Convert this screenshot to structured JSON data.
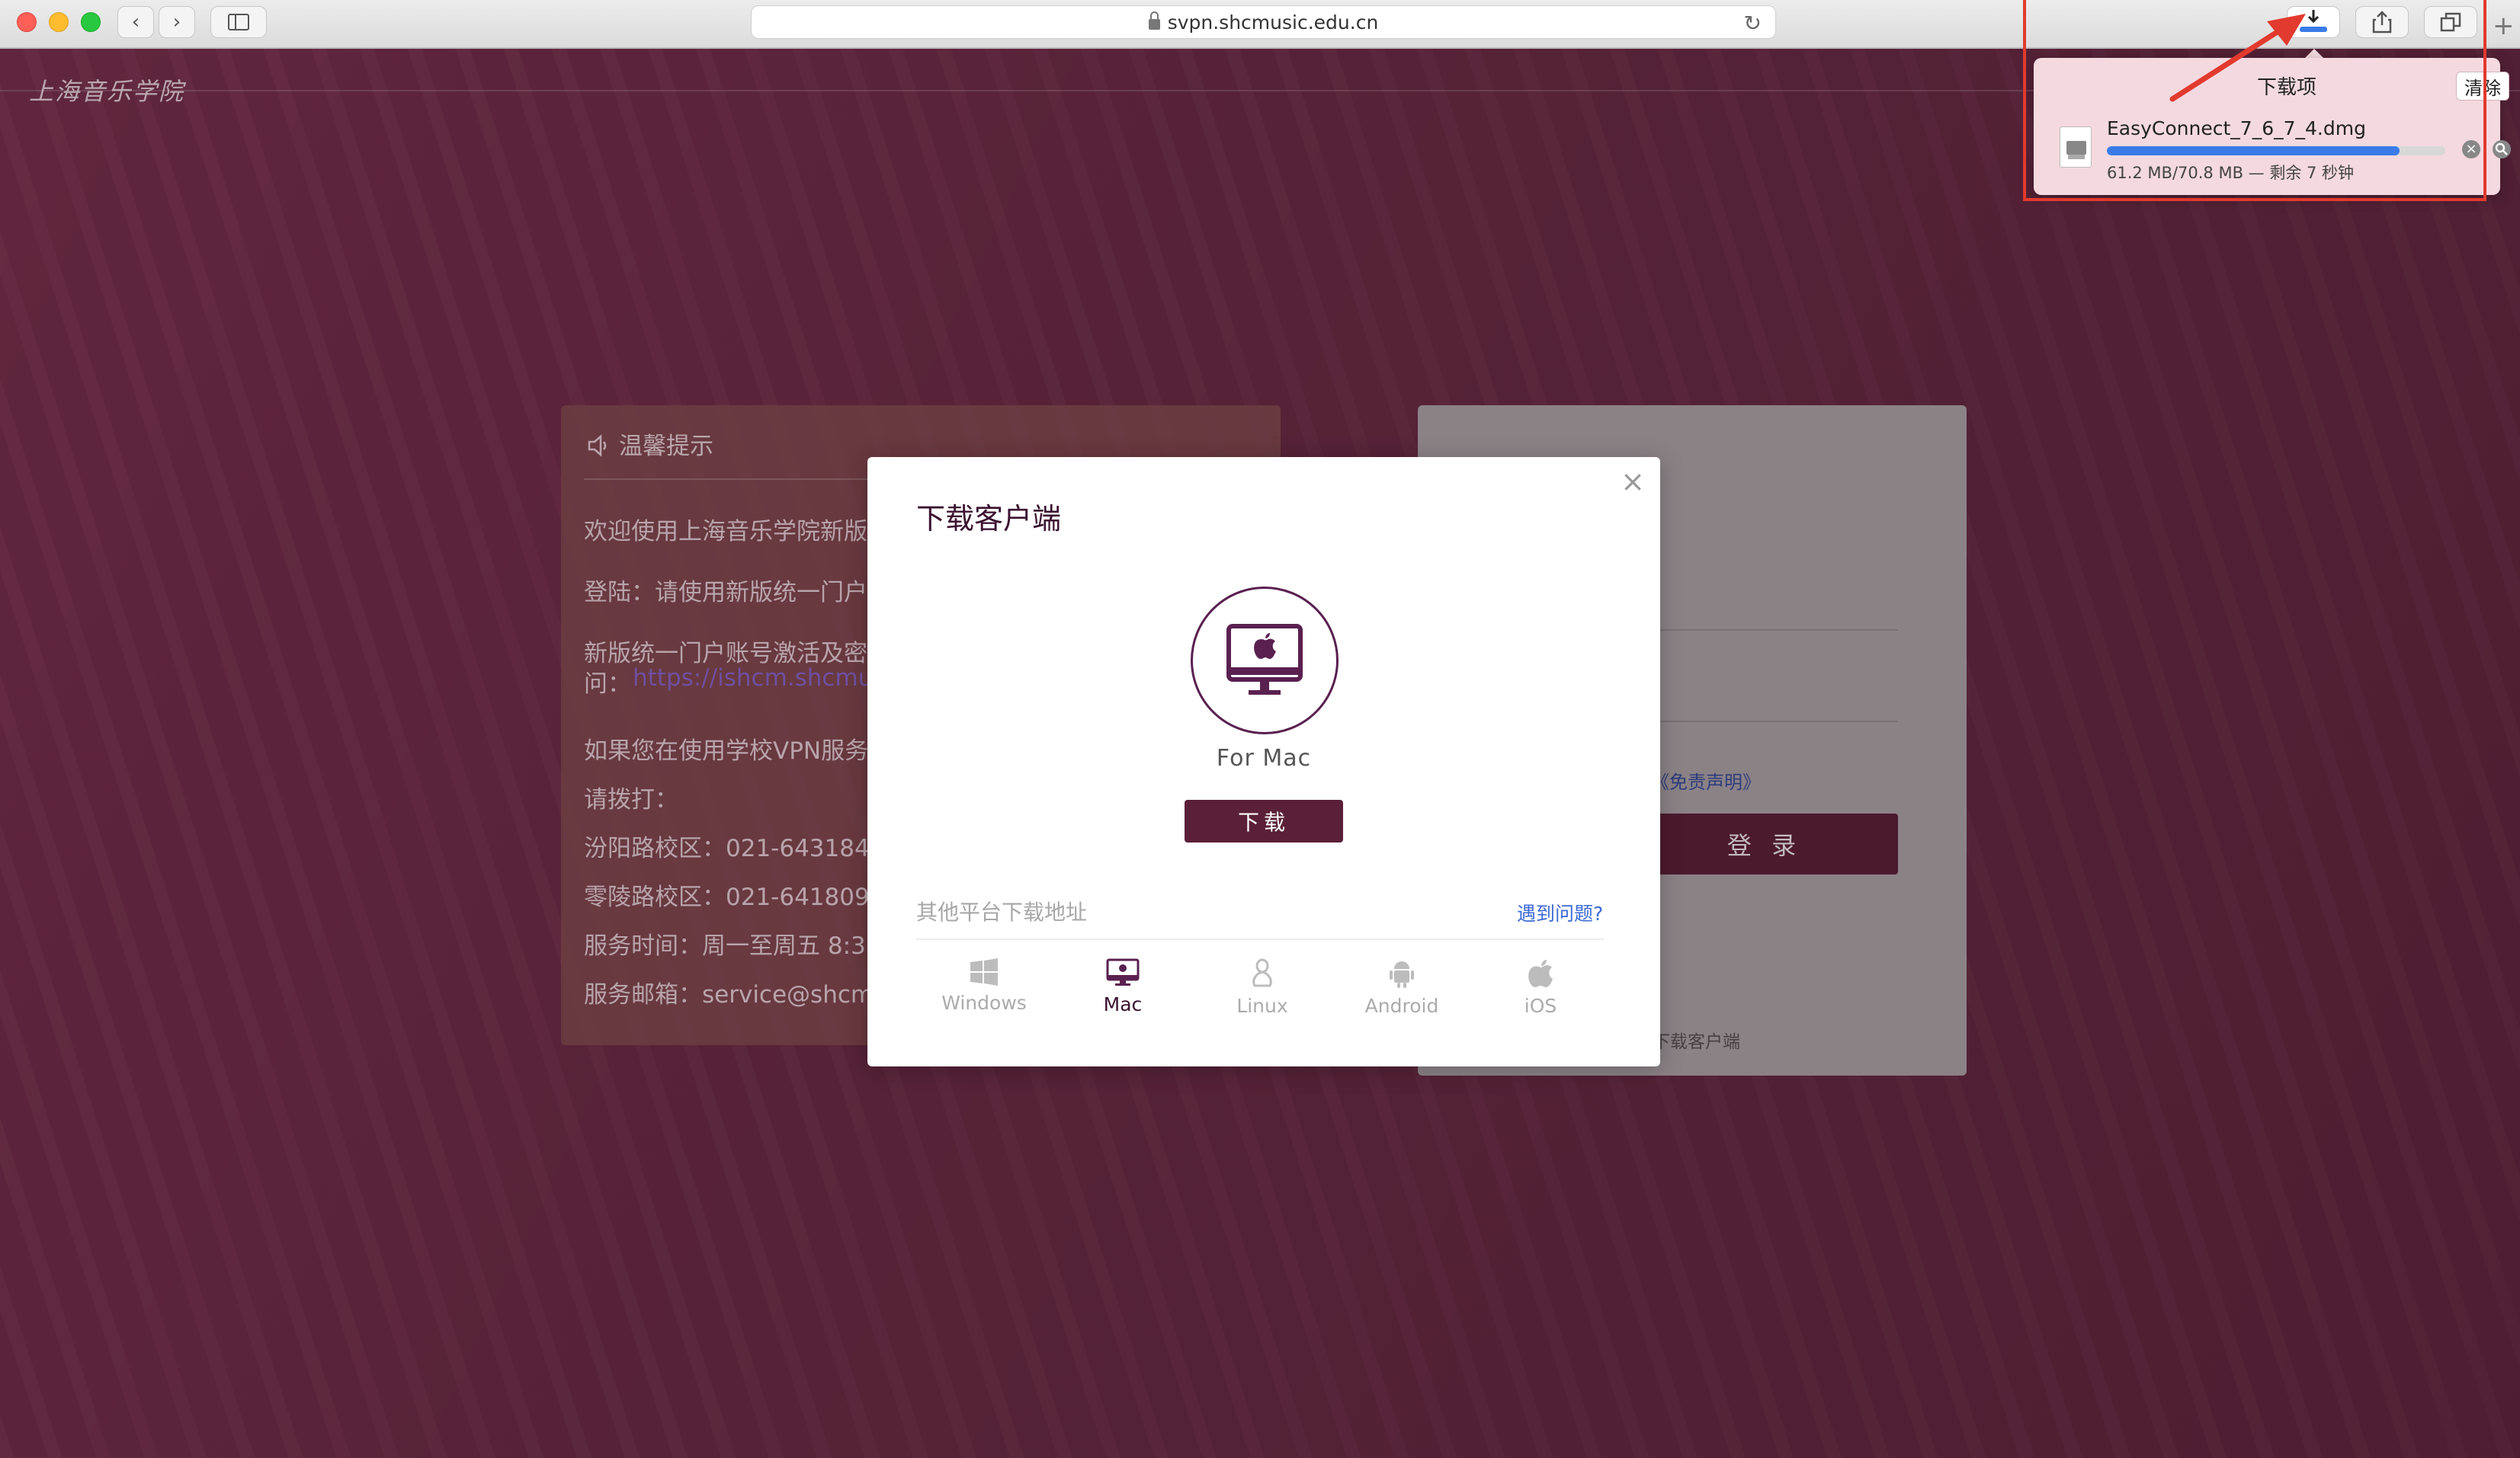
{
  "browser": {
    "url": "svpn.shcmusic.edu.cn"
  },
  "site": {
    "logo_text": "上海音乐学院"
  },
  "notice": {
    "title": "温馨提示",
    "lines": [
      "欢迎使用上海音乐学院新版",
      "登陆：请使用新版统一门户",
      "新版统一门户账号激活及密",
      "问：",
      "如果您在使用学校VPN服务",
      "请拨打：",
      "汾阳路校区：021-643184",
      "零陵路校区：021-641809",
      "服务时间：周一至周五 8:3",
      "服务邮箱：service@shcm"
    ],
    "link": "https://ishcm.shcmu"
  },
  "login": {
    "disclaimer_link": "《免责声明》",
    "login_button": "登 录",
    "download_client_text": "下载客户端"
  },
  "modal": {
    "title": "下载客户端",
    "close_label": "×",
    "platform_name": "For Mac",
    "download_button": "下载",
    "other_platforms_label": "其他平台下载地址",
    "problem_link": "遇到问题?",
    "platforms": [
      {
        "label": "Windows",
        "icon": "windows-icon",
        "active": false
      },
      {
        "label": "Mac",
        "icon": "mac-monitor-icon",
        "active": true
      },
      {
        "label": "Linux",
        "icon": "linux-icon",
        "active": false
      },
      {
        "label": "Android",
        "icon": "android-icon",
        "active": false
      },
      {
        "label": "iOS",
        "icon": "apple-icon",
        "active": false
      }
    ]
  },
  "downloads": {
    "title": "下载项",
    "clear_label": "清除",
    "file_name": "EasyConnect_7_6_7_4.dmg",
    "status": "61.2 MB/70.8 MB — 剩余 7 秒钟",
    "progress": 0.864
  },
  "colors": {
    "brand": "#5a2037",
    "annotation": "#e23a2e",
    "progress": "#3a7be8"
  }
}
